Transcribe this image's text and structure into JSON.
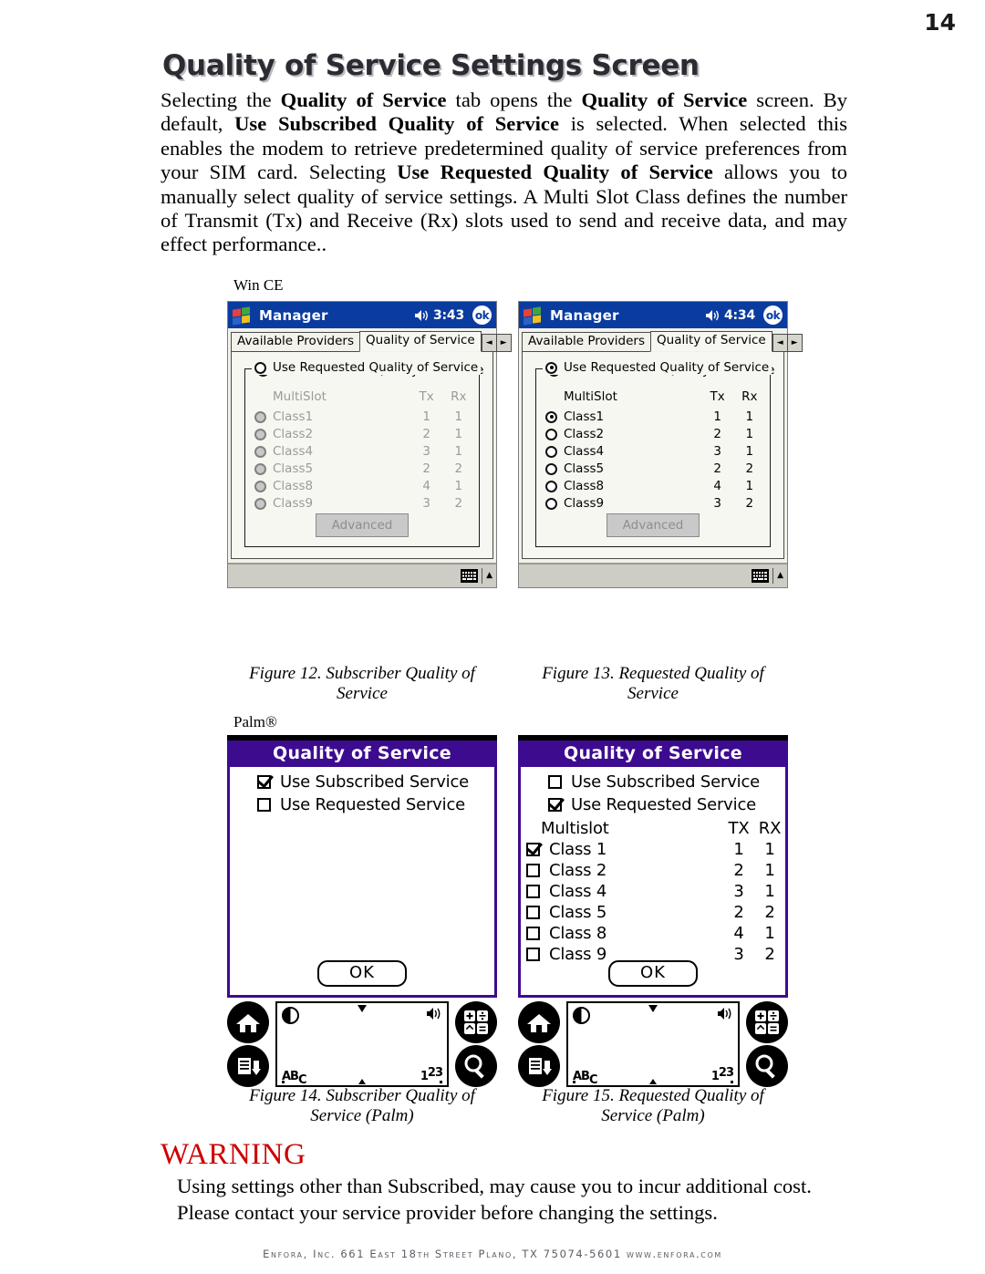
{
  "page": {
    "number": "14",
    "title": "Quality of Service Settings Screen"
  },
  "intro": {
    "html": "Selecting the <b>Quality of Service</b> tab opens the <b>Quality of Service</b> screen.  By default, <b>Use Subscribed Quality of Service</b> is selected.  When selected this enables the modem to retrieve predetermined quality of service preferences from your SIM card.  Selecting <b>Use Requested Quality of Service</b> allows you to manually select quality of service settings.  A Multi Slot Class defines the number of Transmit (Tx) and Receive (Rx) slots used to send and receive data, and may effect performance.."
  },
  "os_labels": {
    "wince": "Win CE",
    "palm": "Palm®"
  },
  "wince": {
    "titlebar": {
      "app_title": "Manager",
      "ok_label": "ok",
      "speaker_icon": "speaker-icon",
      "windows_logo_icon": "windows-logo-icon"
    },
    "tabs": {
      "inactive_label": "Available Providers",
      "active_label": "Quality of Service",
      "prev_arrow": "◄",
      "next_arrow": "►"
    },
    "radios": {
      "subscribed": "Use Subscribed Quality of Service",
      "requested": "Use Requested Quality of Service"
    },
    "table": {
      "headers": [
        "MultiSlot",
        "Tx",
        "Rx"
      ],
      "rows": [
        {
          "name": "Class1",
          "tx": "1",
          "rx": "1"
        },
        {
          "name": "Class2",
          "tx": "2",
          "rx": "1"
        },
        {
          "name": "Class4",
          "tx": "3",
          "rx": "1"
        },
        {
          "name": "Class5",
          "tx": "2",
          "rx": "2"
        },
        {
          "name": "Class8",
          "tx": "4",
          "rx": "1"
        },
        {
          "name": "Class9",
          "tx": "3",
          "rx": "2"
        }
      ]
    },
    "advanced_label": "Advanced",
    "taskbar": {
      "keyboard_icon": "keyboard-icon",
      "up_arrow": "▲"
    },
    "screens": [
      {
        "time": "3:43",
        "selected_mode": "subscribed",
        "classes_enabled": false,
        "selected_class": null
      },
      {
        "time": "4:34",
        "selected_mode": "requested",
        "classes_enabled": true,
        "selected_class": "Class1"
      }
    ]
  },
  "palm": {
    "title": "Quality of Service",
    "checkboxes": {
      "subscribed": "Use Subscribed Service",
      "requested": "Use Requested Service"
    },
    "table": {
      "headers": [
        "Multislot",
        "TX",
        "RX"
      ],
      "rows": [
        {
          "name": "Class 1",
          "tx": "1",
          "rx": "1"
        },
        {
          "name": "Class 2",
          "tx": "2",
          "rx": "1"
        },
        {
          "name": "Class 4",
          "tx": "3",
          "rx": "1"
        },
        {
          "name": "Class 5",
          "tx": "2",
          "rx": "2"
        },
        {
          "name": "Class 8",
          "tx": "4",
          "rx": "1"
        },
        {
          "name": "Class 9",
          "tx": "3",
          "rx": "2"
        }
      ]
    },
    "ok_label": "OK",
    "silkscreen": {
      "home_icon": "home-icon",
      "menu_icon": "menu-icon",
      "calculator_icon": "calculator-icon",
      "search_icon": "search-icon",
      "contrast_icon": "contrast-icon",
      "volume_icon": "volume-icon",
      "abc_label": "ABC",
      "num_label": "123"
    },
    "screens": [
      {
        "subscribed_checked": true,
        "requested_checked": false,
        "show_table": false,
        "selected_class": null
      },
      {
        "subscribed_checked": false,
        "requested_checked": true,
        "show_table": true,
        "selected_class": "Class 1"
      }
    ]
  },
  "captions": {
    "fig12": "Figure 12.  Subscriber Quality of Service",
    "fig13": "Figure 13. Requested Quality of Service",
    "fig14": "Figure 14.  Subscriber Quality of Service (Palm)",
    "fig15": "Figure 15. Requested Quality of Service (Palm)"
  },
  "warning": {
    "heading": "WARNING",
    "body": "Using settings other than Subscribed, may cause you to incur additional cost.  Please contact your service provider before changing the settings."
  },
  "footer": {
    "text": "Enfora, Inc.  661 East 18th Street  Plano, TX  75074-5601  www.enfora.com"
  },
  "colors": {
    "title_shadow": "#b9b9bf",
    "wince_titlebar": "#0a3ca0",
    "palm_titlebar": "#3d0b8f",
    "warning_red": "#cc0000",
    "footer_gray": "#5c5c66"
  }
}
